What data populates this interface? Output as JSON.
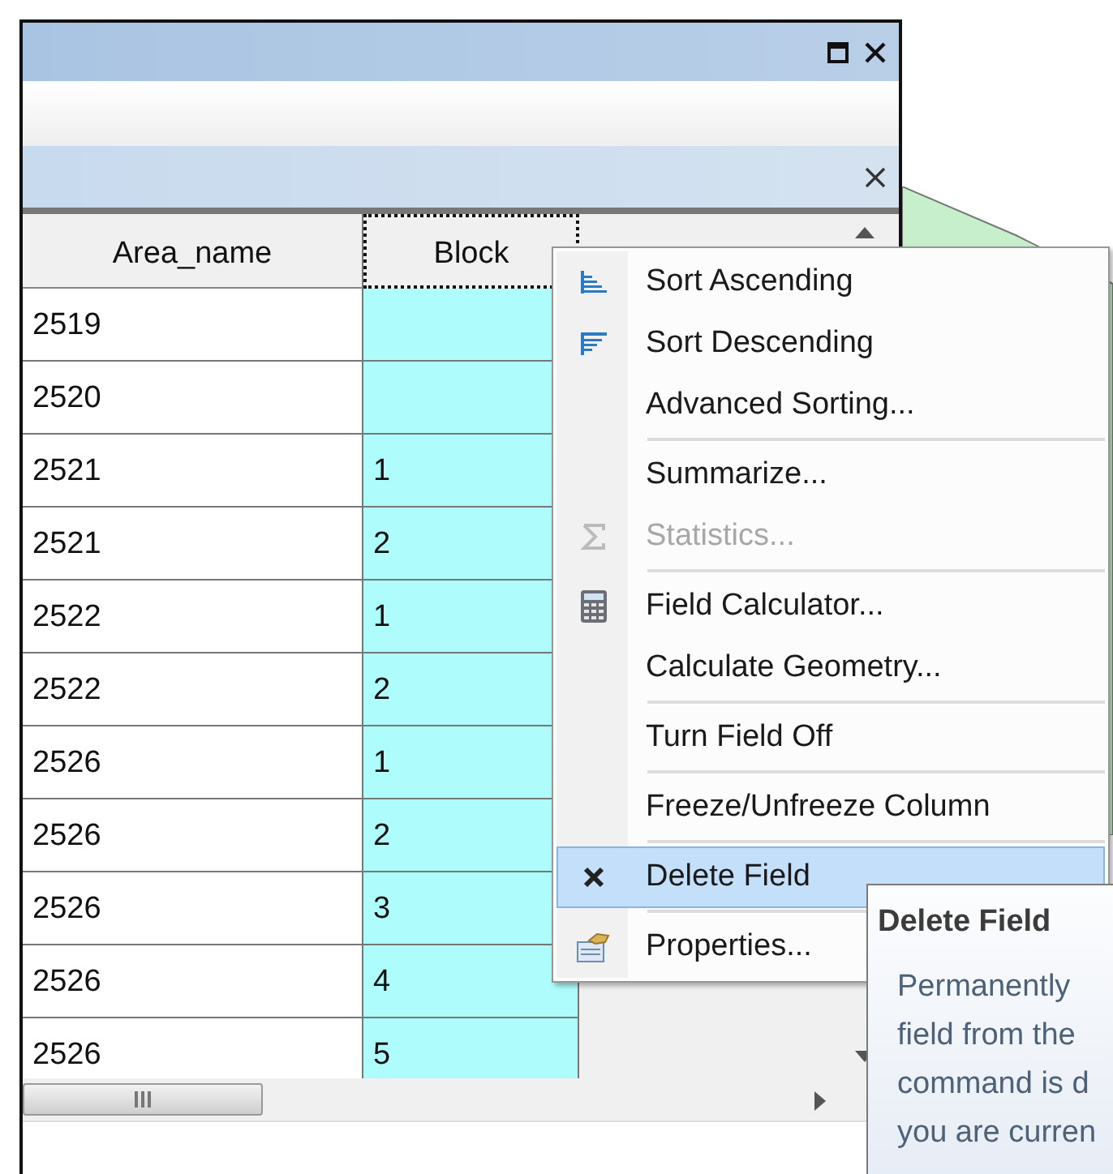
{
  "table": {
    "columns": [
      {
        "label": "Area_name",
        "selected": false
      },
      {
        "label": "Block",
        "selected": true
      }
    ],
    "rows": [
      [
        "2519",
        ""
      ],
      [
        "2520",
        ""
      ],
      [
        "2521",
        "1"
      ],
      [
        "2521",
        "2"
      ],
      [
        "2522",
        "1"
      ],
      [
        "2522",
        "2"
      ],
      [
        "2526",
        "1"
      ],
      [
        "2526",
        "2"
      ],
      [
        "2526",
        "3"
      ],
      [
        "2526",
        "4"
      ],
      [
        "2526",
        "5"
      ]
    ]
  },
  "context_menu": {
    "groups": [
      [
        {
          "label": "Sort Ascending",
          "kind": "sort-asc",
          "disabled": false,
          "selected": false
        },
        {
          "label": "Sort Descending",
          "kind": "sort-desc",
          "disabled": false,
          "selected": false
        },
        {
          "label": "Advanced Sorting...",
          "disabled": false,
          "selected": false
        }
      ],
      [
        {
          "label": "Summarize...",
          "disabled": false,
          "selected": false
        },
        {
          "label": "Statistics...",
          "kind": "sigma",
          "disabled": true,
          "selected": false
        }
      ],
      [
        {
          "label": "Field Calculator...",
          "kind": "calculator",
          "disabled": false,
          "selected": false
        },
        {
          "label": "Calculate Geometry...",
          "disabled": false,
          "selected": false
        }
      ],
      [
        {
          "label": "Turn Field Off",
          "disabled": false,
          "selected": false
        }
      ],
      [
        {
          "label": "Freeze/Unfreeze Column",
          "disabled": false,
          "selected": false
        }
      ],
      [
        {
          "label": "Delete Field",
          "kind": "delete",
          "disabled": false,
          "selected": true
        }
      ],
      [
        {
          "label": "Properties...",
          "kind": "properties",
          "disabled": false,
          "selected": false
        }
      ]
    ]
  },
  "tooltip": {
    "title": "Delete Field",
    "lines": [
      "Permanently",
      "field from the",
      "command is d",
      "you are curren"
    ]
  }
}
